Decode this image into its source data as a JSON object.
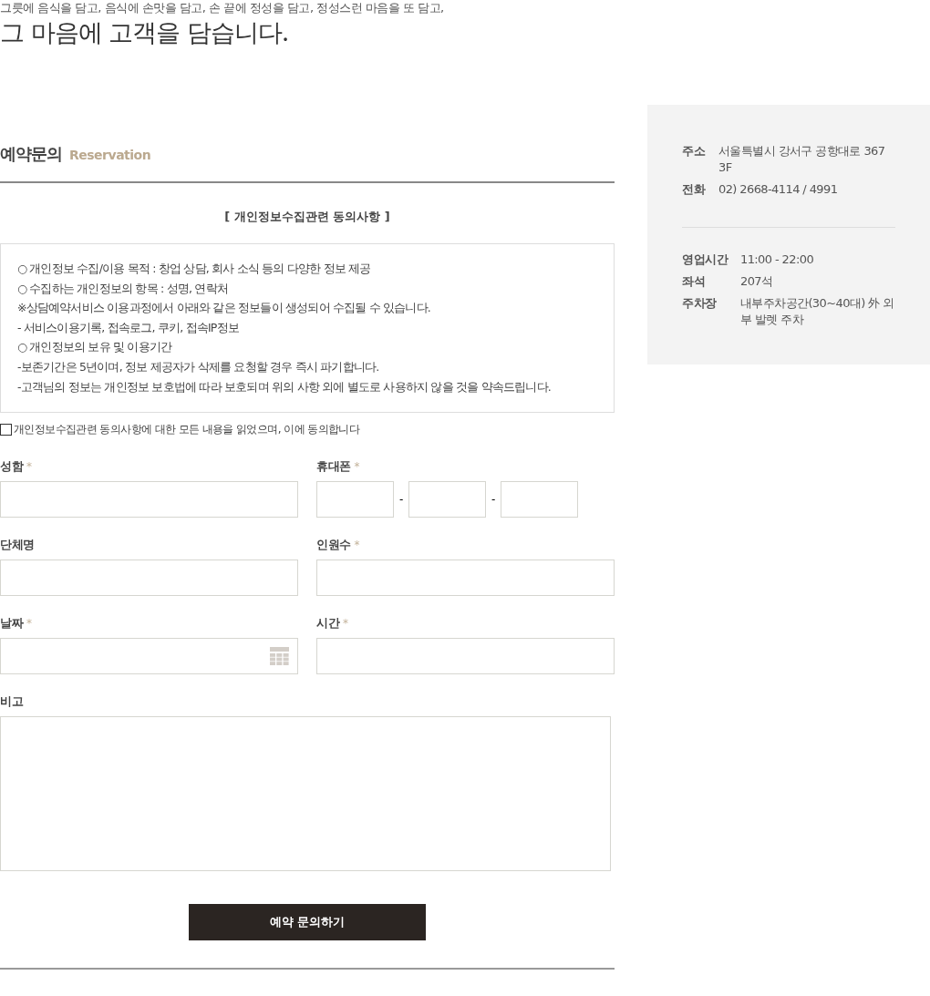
{
  "intro": {
    "line": "그릇에 음식을 담고, 음식에 손맛을 담고, 손 끝에 정성을 담고, 정성스런 마음을 또 담고,",
    "headline": "그 마음에 고객을 담습니다."
  },
  "section": {
    "title": "예약문의",
    "subtitle": "Reservation"
  },
  "terms": {
    "title": "[ 개인정보수집관련 동의사항 ]",
    "lines": [
      "○ 개인정보 수집/이용 목적 : 창업 상담, 회사 소식 등의 다양한 정보 제공",
      "○ 수집하는 개인정보의 항목 : 성명, 연락처",
      "※상담예약서비스 이용과정에서 아래와 같은 정보들이 생성되어 수집될 수 있습니다.",
      "- 서비스이용기록, 접속로그, 쿠키, 접속IP정보",
      "○ 개인정보의 보유 및 이용기간",
      "-보존기간은 5년이며, 정보 제공자가 삭제를 요청할 경우 즉시 파기합니다.",
      "-고객님의 정보는 개인정보 보호법에 따라 보호되며 위의 사항 외에 별도로 사용하지 않을 것을 약속드립니다."
    ]
  },
  "agree": {
    "label": "개인정보수집관련 동의사항에 대한 모든 내용을 읽었으며, 이에 동의합니다",
    "checked": false
  },
  "fields": [
    {
      "label": "성함",
      "required": true,
      "kind": "text"
    },
    {
      "label": "휴대폰",
      "required": true,
      "kind": "phone",
      "separators": [
        "-",
        "-"
      ]
    },
    {
      "label": "단체명",
      "required": false,
      "kind": "text"
    },
    {
      "label": "인원수",
      "required": true,
      "kind": "text"
    },
    {
      "label": "날짜",
      "required": true,
      "kind": "date"
    },
    {
      "label": "시간",
      "required": true,
      "kind": "text"
    },
    {
      "label": "비고",
      "required": false,
      "kind": "textarea"
    }
  ],
  "required_mark": "*",
  "submit": "예약 문의하기",
  "info": {
    "groups": [
      [
        {
          "label": "주소",
          "value": "서울특별시 강서구 공항대로 367 3F"
        },
        {
          "label": "전화",
          "value": "02) 2668-4114 / 4991"
        }
      ],
      [
        {
          "label": "영업시간",
          "value": "11:00 - 22:00"
        },
        {
          "label": "좌석",
          "value": "207석"
        },
        {
          "label": "주차장",
          "value": "내부주차공간(30~40대) 外 외부 발렛 주차"
        }
      ]
    ]
  }
}
